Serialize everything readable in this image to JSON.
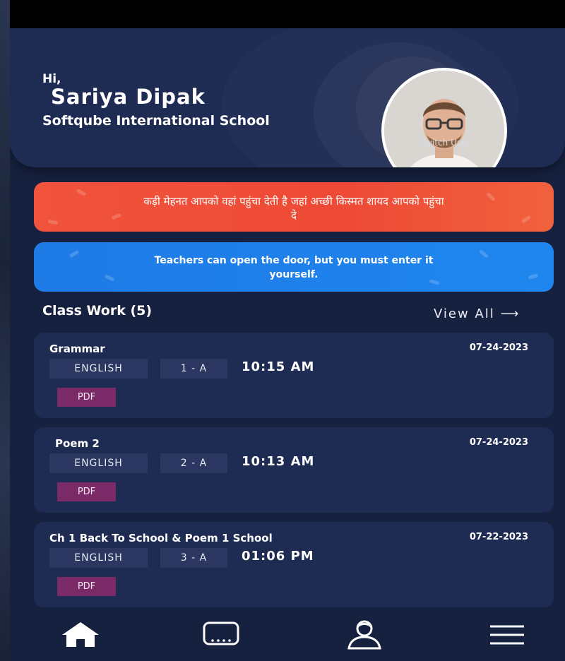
{
  "header": {
    "greeting": "Hi,",
    "user_name": "Sariya Dipak",
    "school_name": "Softqube International School",
    "switch_user_label": "Switch User"
  },
  "quotes": [
    {
      "text": "कड़ी मेहनत आपको वहां पहुंचा देती है जहां अच्छी किस्मत शायद आपको पहुंचा दे",
      "color": "#f1533c"
    },
    {
      "text": "Teachers can open the door, but you must enter it yourself.",
      "color": "#1f7be6"
    }
  ],
  "class_work": {
    "title": "Class Work (5)",
    "view_all_label": "View All ⟶",
    "items": [
      {
        "title": "Grammar",
        "date": "07-24-2023",
        "subject": "ENGLISH",
        "class": "1 - A",
        "time": "10:15 AM",
        "attachment": "PDF"
      },
      {
        "title": "Poem 2",
        "date": "07-24-2023",
        "subject": "ENGLISH",
        "class": "2 - A",
        "time": "10:13 AM",
        "attachment": "PDF"
      },
      {
        "title": "Ch 1 Back To School & Poem 1 School",
        "date": "07-22-2023",
        "subject": "ENGLISH",
        "class": "3 - A",
        "time": "01:06 PM",
        "attachment": "PDF"
      }
    ]
  },
  "bottom_nav": {
    "items": [
      {
        "icon": "home-icon"
      },
      {
        "icon": "classroom-screen-icon"
      },
      {
        "icon": "profile-icon"
      },
      {
        "icon": "menu-icon"
      }
    ]
  },
  "colors": {
    "background": "#16213f",
    "card": "#1e2b52",
    "chip": "#2b3760",
    "pdf_badge": "#7b2a68"
  }
}
